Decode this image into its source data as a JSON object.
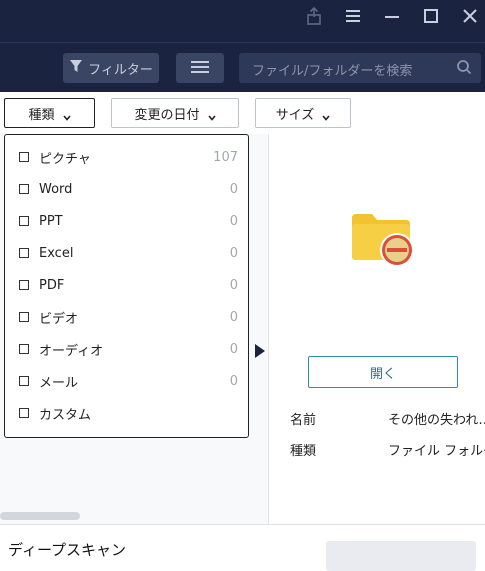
{
  "toolbar": {
    "filter_label": "フィルター",
    "search_placeholder": "ファイル/フォルダーを検索"
  },
  "filters": {
    "type_label": "種類",
    "modified_label": "変更の日付",
    "size_label": "サイズ"
  },
  "dropdown": {
    "items": [
      {
        "label": "ピクチャ",
        "count": "107"
      },
      {
        "label": "Word",
        "count": "0"
      },
      {
        "label": "PPT",
        "count": "0"
      },
      {
        "label": "Excel",
        "count": "0"
      },
      {
        "label": "PDF",
        "count": "0"
      },
      {
        "label": "ビデオ",
        "count": "0"
      },
      {
        "label": "オーディオ",
        "count": "0"
      },
      {
        "label": "メール",
        "count": "0"
      },
      {
        "label": "カスタム",
        "count": ""
      }
    ]
  },
  "details": {
    "open_label": "開く",
    "name_key": "名前",
    "name_value": "その他の失われ…",
    "type_key": "種類",
    "type_value": "ファイル フォルダー"
  },
  "bottom": {
    "deep_scan_label": "ディープスキャン"
  },
  "colors": {
    "header_bg": "#1a2340",
    "accent": "#2f8ea0",
    "folder": "#f2c230",
    "remove_badge": "#d94f38"
  }
}
